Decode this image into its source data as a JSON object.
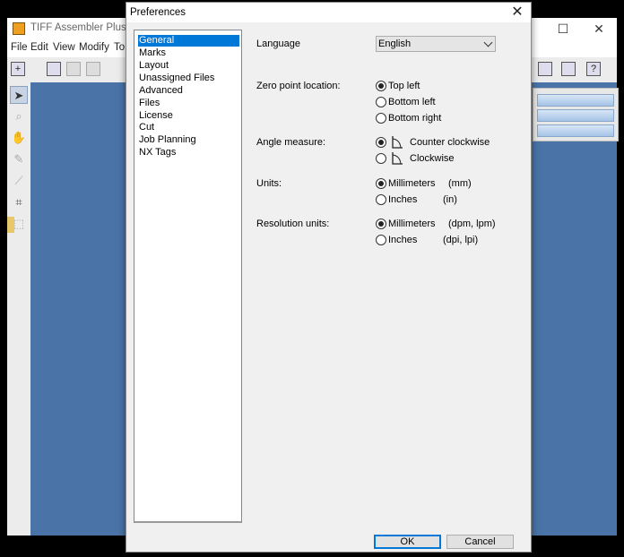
{
  "app": {
    "title": "TIFF Assembler Plus FLE",
    "menu": [
      "File",
      "Edit",
      "View",
      "Modify",
      "To"
    ],
    "window_controls": {
      "maximize": "☐",
      "close": "✕"
    },
    "canvas_color": "#4a74a8"
  },
  "dialog": {
    "title": "Preferences",
    "close_glyph": "✕",
    "categories": [
      "General",
      "Marks",
      "Layout",
      "Unassigned Files",
      "Advanced",
      "Files",
      "License",
      "Cut",
      "Job Planning",
      "NX Tags"
    ],
    "selected_category": "General",
    "language": {
      "label": "Language",
      "value": "English"
    },
    "zero_point": {
      "label": "Zero point location:",
      "options": [
        "Top left",
        "Bottom left",
        "Bottom right"
      ],
      "selected": "Top left"
    },
    "angle": {
      "label": "Angle measure:",
      "options": [
        "Counter clockwise",
        "Clockwise"
      ],
      "selected": "Counter clockwise"
    },
    "units": {
      "label": "Units:",
      "options": [
        {
          "name": "Millimeters",
          "abbr": "(mm)"
        },
        {
          "name": "Inches",
          "abbr": "(in)"
        }
      ],
      "selected": "Millimeters"
    },
    "resolution": {
      "label": "Resolution units:",
      "options": [
        {
          "name": "Millimeters",
          "abbr": "(dpm, lpm)"
        },
        {
          "name": "Inches",
          "abbr": "(dpi, lpi)"
        }
      ],
      "selected": "Millimeters"
    },
    "buttons": {
      "ok": "OK",
      "cancel": "Cancel"
    },
    "accent": "#0078d7"
  }
}
